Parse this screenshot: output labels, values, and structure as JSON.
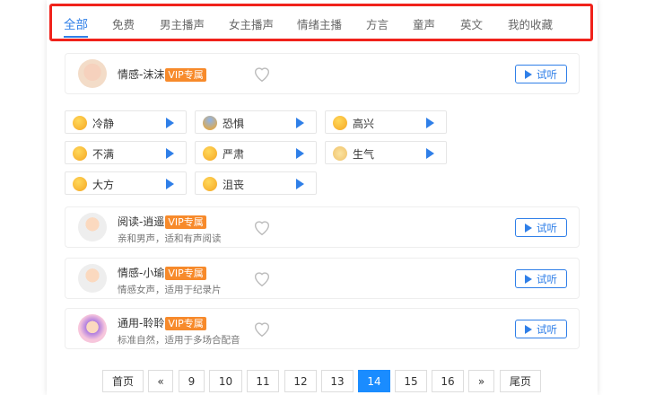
{
  "tabs": [
    "全部",
    "免费",
    "男主播声",
    "女主播声",
    "情绪主播",
    "方言",
    "童声",
    "英文",
    "我的收藏"
  ],
  "featured": {
    "name": "情感-沫沫",
    "badge": "VIP专属",
    "listen": "试听"
  },
  "emotions": [
    "冷静",
    "恐惧",
    "高兴",
    "不满",
    "严肃",
    "生气",
    "大方",
    "沮丧"
  ],
  "voices": [
    {
      "name": "阅读-逍遥",
      "badge": "VIP专属",
      "desc": "亲和男声，适和有声阅读",
      "listen": "试听"
    },
    {
      "name": "情感-小瑜",
      "badge": "VIP专属",
      "desc": "情感女声，适用于纪录片",
      "listen": "试听"
    },
    {
      "name": "通用-聆聆",
      "badge": "VIP专属",
      "desc": "标准自然，适用于多场合配音",
      "listen": "试听"
    }
  ],
  "pagination": {
    "first": "首页",
    "prev": "«",
    "pages": [
      "9",
      "10",
      "11",
      "12",
      "13",
      "14",
      "15",
      "16"
    ],
    "current": "14",
    "next": "»",
    "last": "尾页"
  },
  "colors": {
    "accent": "#2f7fe8",
    "vip": "#f78a2b",
    "highlight": "#f0221b",
    "page_active": "#1a8cff"
  }
}
